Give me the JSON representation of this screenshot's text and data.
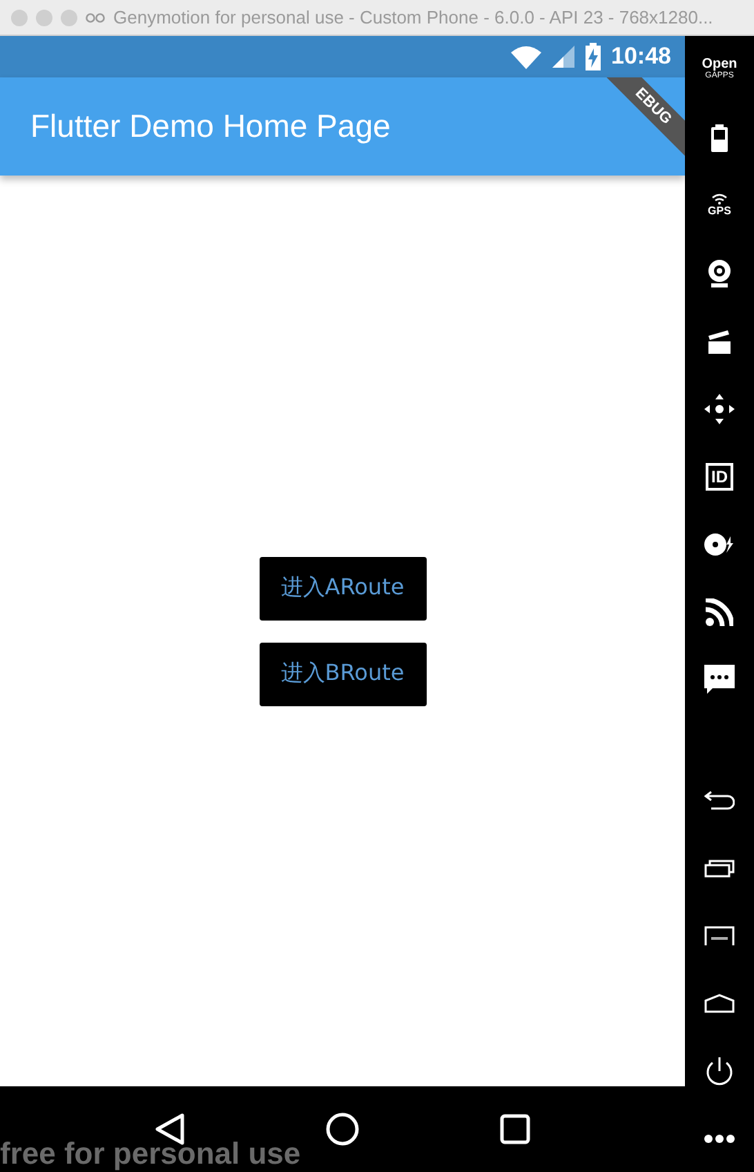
{
  "window": {
    "title": "Genymotion for personal use - Custom Phone - 6.0.0 - API 23 - 768x1280..."
  },
  "status_bar": {
    "time": "10:48"
  },
  "debug_banner": {
    "label": "EBUG"
  },
  "app_bar": {
    "title": "Flutter Demo Home Page"
  },
  "buttons": [
    {
      "label": "进入ARoute"
    },
    {
      "label": "进入BRoute"
    }
  ],
  "nav_bar": [
    {
      "kind": "back"
    },
    {
      "kind": "home"
    },
    {
      "kind": "recents"
    }
  ],
  "overlay_text": "free for personal use",
  "side_toolbar": {
    "top": [
      {
        "kind": "gapps",
        "label": "Open",
        "sublabel": "GAPPS"
      },
      {
        "kind": "battery"
      },
      {
        "kind": "gps",
        "label": "GPS"
      },
      {
        "kind": "webcam"
      },
      {
        "kind": "clapper"
      },
      {
        "kind": "move"
      },
      {
        "kind": "id",
        "label": "ID"
      },
      {
        "kind": "disc"
      },
      {
        "kind": "cast"
      },
      {
        "kind": "message"
      }
    ],
    "bottom": [
      {
        "kind": "back"
      },
      {
        "kind": "recents"
      },
      {
        "kind": "menu"
      },
      {
        "kind": "home"
      },
      {
        "kind": "power"
      },
      {
        "kind": "more"
      }
    ]
  }
}
